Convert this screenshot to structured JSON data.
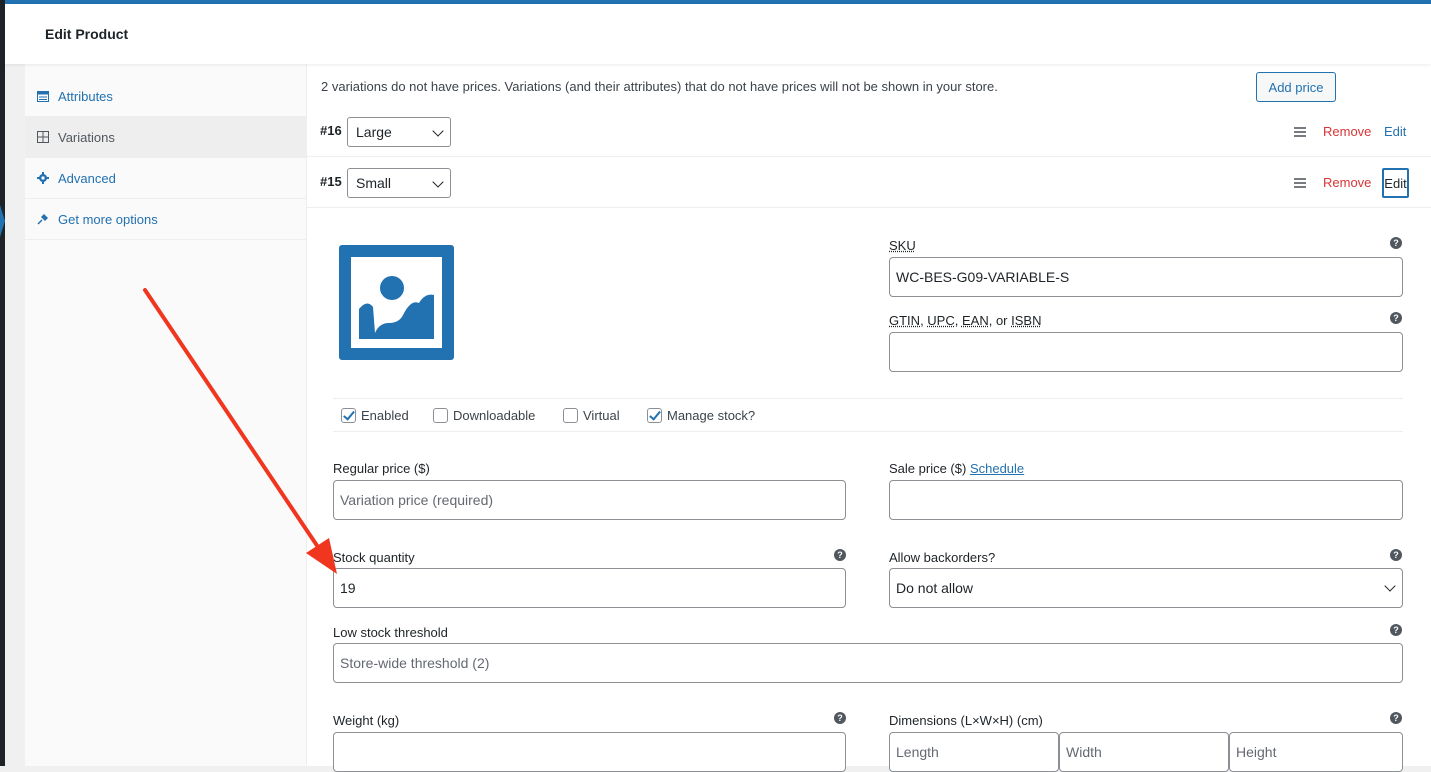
{
  "header": {
    "title": "Edit Product"
  },
  "tabs": [
    {
      "label": "Attributes",
      "icon": "table-icon"
    },
    {
      "label": "Variations",
      "icon": "grid-icon"
    },
    {
      "label": "Advanced",
      "icon": "gear-icon"
    },
    {
      "label": "Get more options",
      "icon": "plugin-icon"
    }
  ],
  "notice": "2 variations do not have prices. Variations (and their attributes) that do not have prices will not be shown in your store.",
  "add_price_label": "Add price",
  "variations": [
    {
      "number": "#16",
      "value": "Large",
      "remove_label": "Remove",
      "edit_label": "Edit"
    },
    {
      "number": "#15",
      "value": "Small",
      "remove_label": "Remove",
      "edit_label": "Edit"
    }
  ],
  "form": {
    "sku_label": "SKU",
    "sku_value": "WC-BES-G09-VARIABLE-S",
    "gtin_label_parts": [
      "GTIN",
      ", ",
      "UPC",
      ", ",
      "EAN",
      ", or ",
      "ISBN"
    ],
    "gtin_value": "",
    "checkboxes": [
      {
        "label": "Enabled",
        "checked": true
      },
      {
        "label": "Downloadable",
        "checked": false
      },
      {
        "label": "Virtual",
        "checked": false
      },
      {
        "label": "Manage stock?",
        "checked": true
      }
    ],
    "regular_price_label": "Regular price ($)",
    "regular_price_placeholder": "Variation price (required)",
    "sale_price_label": "Sale price ($)",
    "schedule_link": "Schedule",
    "stock_quantity_label": "Stock quantity",
    "stock_quantity_value": "19",
    "backorders_label": "Allow backorders?",
    "backorders_value": "Do not allow",
    "low_stock_label": "Low stock threshold",
    "low_stock_placeholder": "Store-wide threshold (2)",
    "weight_label": "Weight (kg)",
    "dimensions_label": "Dimensions (L×W×H) (cm)",
    "length_placeholder": "Length",
    "width_placeholder": "Width",
    "height_placeholder": "Height",
    "help_glyph": "?"
  },
  "colors": {
    "accent": "#2271b1",
    "danger": "#d63638",
    "annotation": "#f0361f"
  }
}
